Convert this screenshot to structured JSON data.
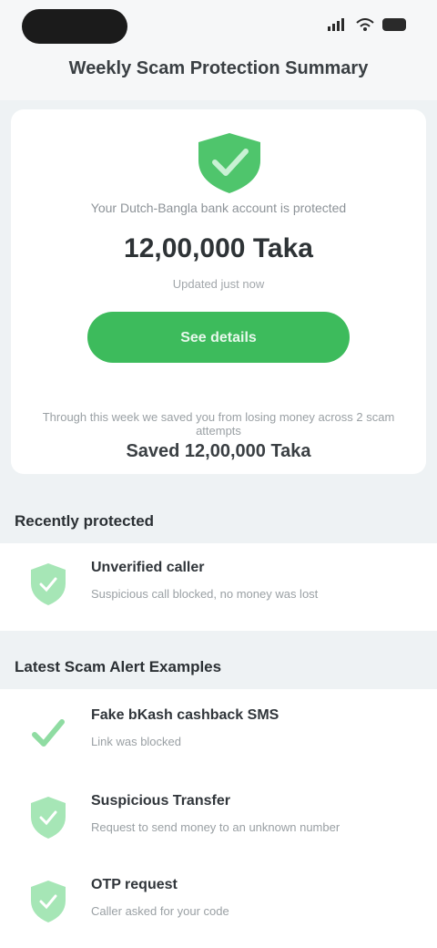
{
  "status_bar": {
    "time": "",
    "icons": [
      "signal-icon",
      "wifi-icon",
      "battery-icon"
    ]
  },
  "header": {
    "title": "Weekly Scam Protection Summary"
  },
  "summary": {
    "icon": "shield-check-icon",
    "caption": "Your Dutch-Bangla bank account is protected",
    "amount": "12,00,000 Taka",
    "sub_caption": "Updated just now",
    "button_label": "See details",
    "note": "Through this week we saved you from losing money across 2 scam attempts",
    "total": "Saved 12,00,000 Taka"
  },
  "sections": [
    {
      "title": "Recently protected",
      "items": [
        {
          "icon": "shield-icon",
          "title": "Unverified caller",
          "subtitle": "Suspicious call blocked, no money was lost"
        }
      ]
    },
    {
      "title": "Latest Scam Alert Examples",
      "items": [
        {
          "icon": "check-icon",
          "title": "Fake bKash cashback SMS",
          "subtitle": "Link was blocked"
        },
        {
          "icon": "shield-icon",
          "title": "Suspicious Transfer",
          "subtitle": "Request to send money to an unknown number"
        },
        {
          "icon": "shield-icon",
          "title": "OTP request",
          "subtitle": "Caller asked for your code"
        }
      ]
    }
  ],
  "colors": {
    "accent": "#3dbb5c",
    "icon_light": "#9be3ae",
    "background": "#eef2f4"
  }
}
